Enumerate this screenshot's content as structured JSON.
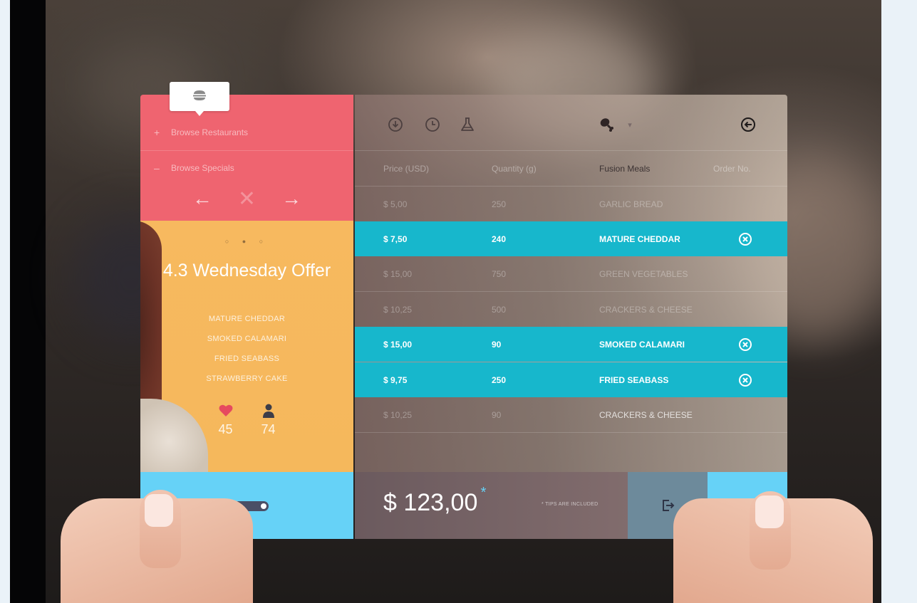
{
  "left_menu": {
    "tooltip_icon": "burger-icon",
    "items": [
      {
        "sign": "+",
        "label": "Browse Restaurants"
      },
      {
        "sign": "–",
        "label": "Browse Specials"
      }
    ],
    "prev": "←",
    "close": "✕",
    "next": "→"
  },
  "promo": {
    "dots": "○ ● ○",
    "title": "4.3 Wednesday Offer",
    "items": [
      "MATURE CHEDDAR",
      "SMOKED CALAMARI",
      "FRIED SEABASS",
      "STRAWBERRY CAKE"
    ],
    "likes": "45",
    "users": "74",
    "like_color": "#e64a5f"
  },
  "toolbar": {
    "icons": [
      "download-icon",
      "clock-icon",
      "flask-icon",
      "drumstick-icon",
      "back-circle-icon"
    ],
    "dropdown_caret": "▾"
  },
  "table": {
    "headers": [
      "Price (USD)",
      "Quantity (g)",
      "Fusion Meals",
      "Order No."
    ],
    "rows": [
      {
        "price": "$ 5,00",
        "qty": "250",
        "meal": "GARLIC BREAD",
        "selected": false
      },
      {
        "price": "$ 7,50",
        "qty": "240",
        "meal": "MATURE CHEDDAR",
        "selected": true
      },
      {
        "price": "$ 15,00",
        "qty": "750",
        "meal": "GREEN VEGETABLES",
        "selected": false
      },
      {
        "price": "$ 10,25",
        "qty": "500",
        "meal": "CRACKERS &  CHEESE",
        "selected": false
      },
      {
        "price": "$ 15,00",
        "qty": "90",
        "meal": "SMOKED CALAMARI",
        "selected": true
      },
      {
        "price": "$ 9,75",
        "qty": "250",
        "meal": "FRIED SEABASS",
        "selected": true
      },
      {
        "price": "$ 10,25",
        "qty": "90",
        "meal": "CRACKERS &  CHEESE",
        "selected": false
      }
    ]
  },
  "footer": {
    "total": "$ 123,00",
    "asterisk": "*",
    "tips_note": "* TIPS ARE INCLUDED"
  },
  "colors": {
    "coral": "#ef6470",
    "sky": "#66d2f7",
    "teal_selected": "#17b7cc",
    "orange": "#f7b95f"
  }
}
